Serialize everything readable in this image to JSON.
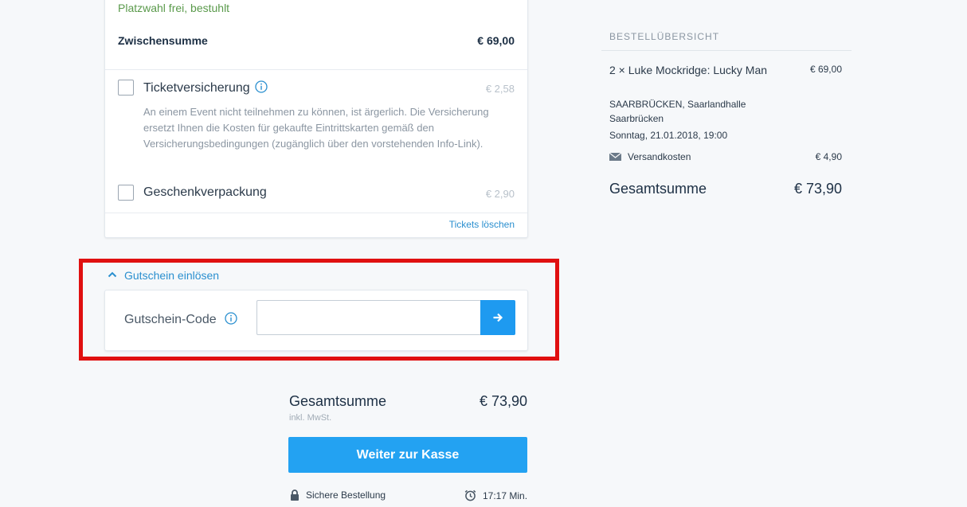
{
  "cart": {
    "seat_info": "Platzwahl frei, bestuhlt",
    "subtotal_label": "Zwischensumme",
    "subtotal_value": "€ 69,00",
    "options": [
      {
        "label": "Ticketversicherung",
        "price": "€ 2,58",
        "description": "An einem Event nicht teilnehmen zu können, ist ärgerlich. Die Versicherung ersetzt Ihnen die Kosten für gekaufte Eintrittskarten gemäß den Versicherungsbedingungen (zugänglich über den vorstehenden Info-Link)."
      },
      {
        "label": "Geschenkverpackung",
        "price": "€ 2,90"
      }
    ],
    "delete_link": "Tickets löschen"
  },
  "voucher": {
    "toggle_label": "Gutschein einlösen",
    "field_label": "Gutschein-Code",
    "input_value": ""
  },
  "checkout": {
    "total_label": "Gesamtsumme",
    "total_value": "€ 73,90",
    "vat_note": "inkl. MwSt.",
    "button_label": "Weiter zur Kasse",
    "secure_label": "Sichere Bestellung",
    "timer": "17:17 Min."
  },
  "summary": {
    "heading": "BESTELLÜBERSICHT",
    "item_name": "2 × Luke Mockridge: Lucky Man",
    "item_price": "€ 69,00",
    "venue": "SAARBRÜCKEN, Saarlandhalle Saarbrücken",
    "date": "Sonntag, 21.01.2018, 19:00",
    "shipping_label": "Versandkosten",
    "shipping_price": "€ 4,90",
    "total_label": "Gesamtsumme",
    "total_value": "€ 73,90"
  },
  "colors": {
    "accent": "#23a2f2",
    "highlight": "#e01010",
    "success_text": "#5a9a4b"
  },
  "icons": [
    "info-icon",
    "chevron-up-icon",
    "arrow-right-icon",
    "lock-icon",
    "alarm-clock-icon",
    "envelope-icon"
  ]
}
